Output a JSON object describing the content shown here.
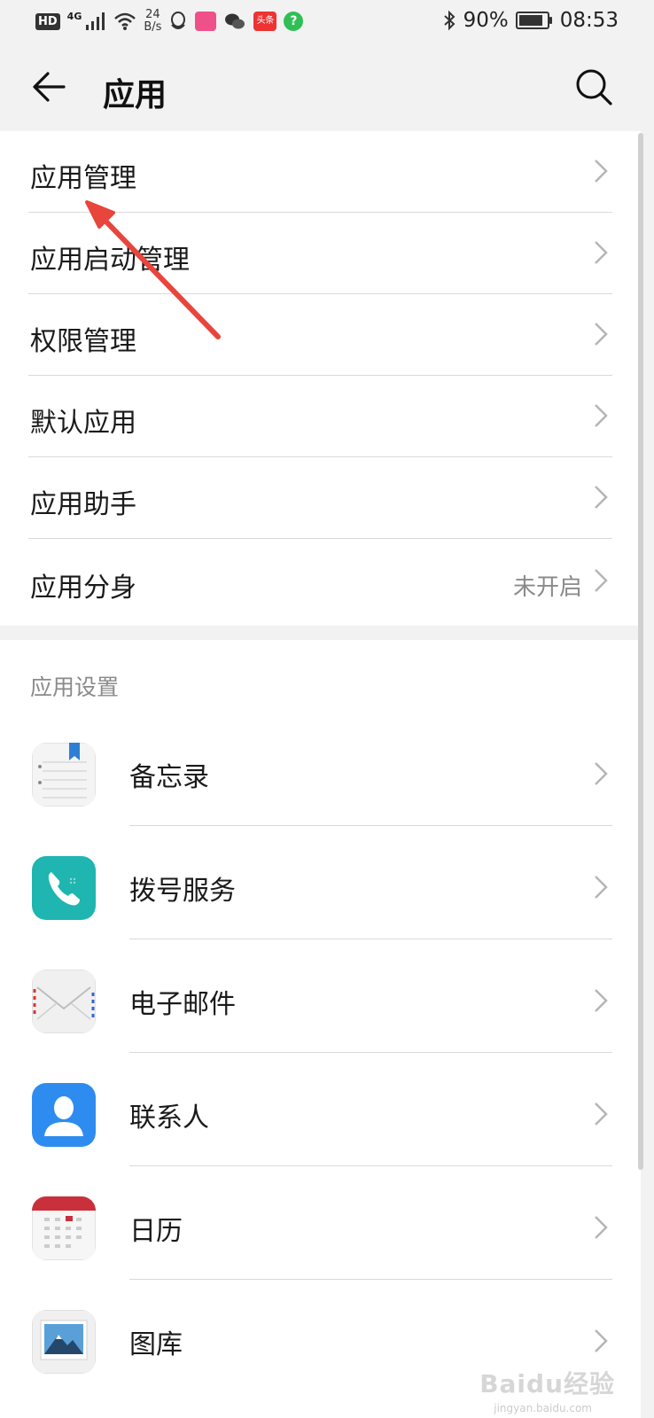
{
  "status_bar": {
    "hd": "HD",
    "network": "4G",
    "speed_value": "24",
    "speed_unit": "B/s",
    "battery": "90%",
    "time": "08:53"
  },
  "header": {
    "title": "应用",
    "back_icon": "arrow-left-icon",
    "search_icon": "search-icon"
  },
  "menu": {
    "items": [
      {
        "label": "应用管理"
      },
      {
        "label": "应用启动管理"
      },
      {
        "label": "权限管理"
      },
      {
        "label": "默认应用"
      },
      {
        "label": "应用助手"
      },
      {
        "label": "应用分身",
        "value": "未开启"
      }
    ]
  },
  "app_settings": {
    "section_label": "应用设置",
    "apps": [
      {
        "label": "备忘录",
        "icon": "notepad-icon"
      },
      {
        "label": "拨号服务",
        "icon": "phone-icon"
      },
      {
        "label": "电子邮件",
        "icon": "email-icon"
      },
      {
        "label": "联系人",
        "icon": "contacts-icon"
      },
      {
        "label": "日历",
        "icon": "calendar-icon"
      },
      {
        "label": "图库",
        "icon": "gallery-icon"
      }
    ]
  },
  "annotation_color": "#e8453c",
  "watermark": {
    "text": "Baidu经验",
    "sub": "jingyan.baidu.com"
  }
}
